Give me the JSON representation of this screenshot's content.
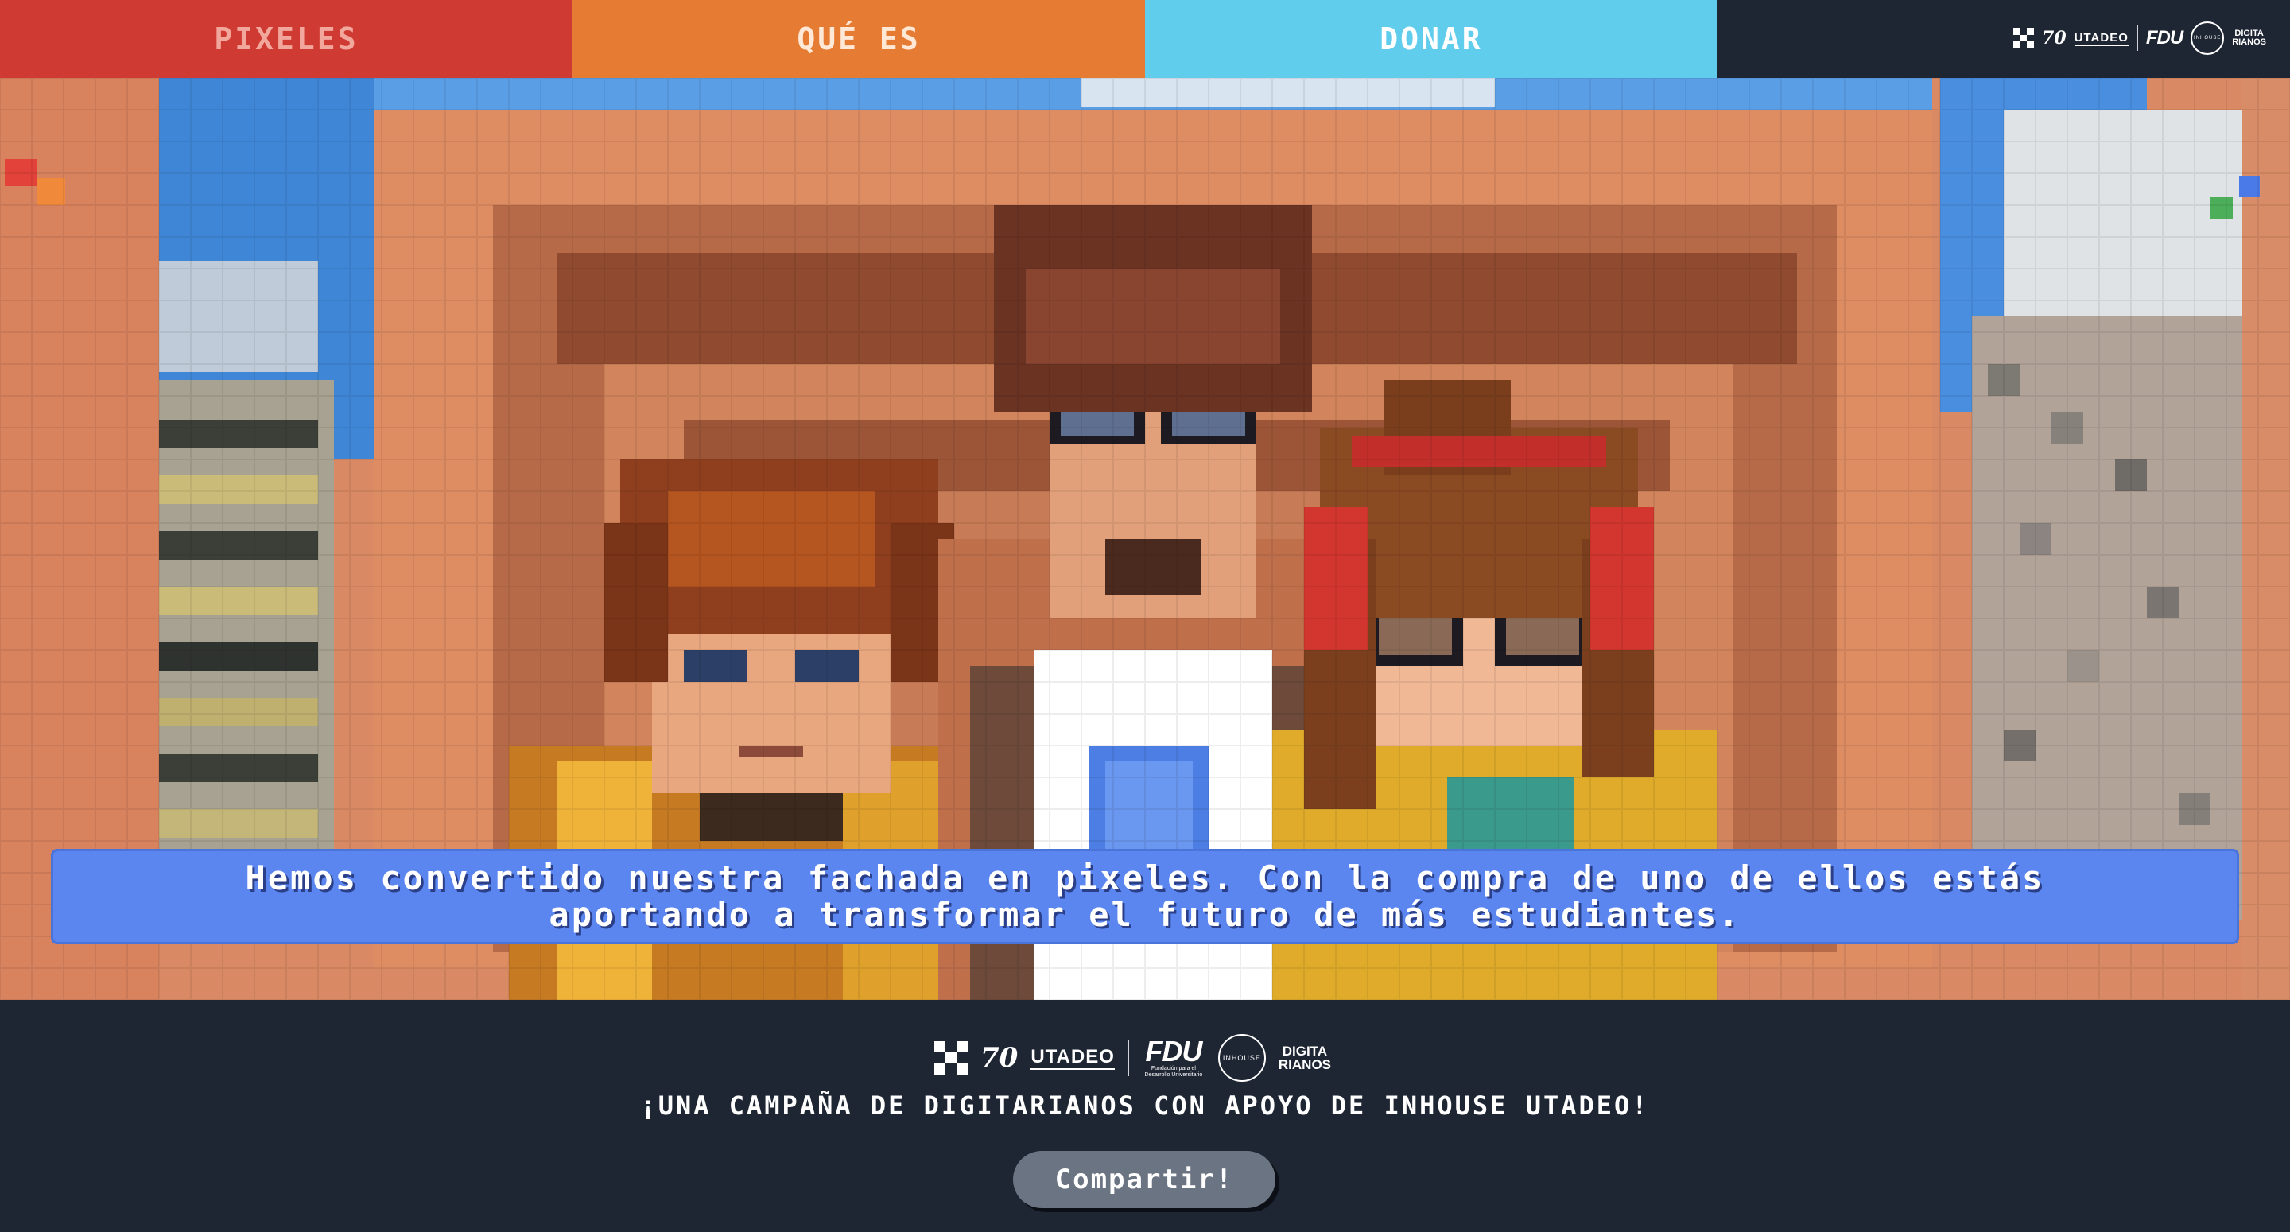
{
  "nav": {
    "tabs": [
      {
        "label": "PIXELES"
      },
      {
        "label": "QUÉ ES"
      },
      {
        "label": "DONAR"
      }
    ],
    "logos": {
      "anniversary": "70",
      "university": "UTADEO",
      "foundation": "FDU",
      "inhouse": "INHOUSE",
      "digitarianos_line1": "DIGITA",
      "digitarianos_line2": "RIANOS"
    }
  },
  "hero": {
    "banner_line1": "Hemos convertido nuestra fachada en pixeles. Con la compra de uno de ellos estás",
    "banner_line2": "aportando a transformar el futuro de más estudiantes."
  },
  "footer": {
    "logos": {
      "anniversary": "70",
      "university": "UTADEO",
      "foundation": "FDU",
      "foundation_caption": "Fundación para el Desarrollo Universitario",
      "inhouse": "INHOUSE",
      "digitarianos_line1": "DIGITA",
      "digitarianos_line2": "RIANOS"
    },
    "campaign_text": "¡UNA CAMPAÑA DE DIGITARIANOS CON APOYO DE INHOUSE UTADEO!",
    "share_label": "Compartir!"
  },
  "colors": {
    "nav_red": "#cf3a33",
    "nav_orange": "#e67b34",
    "nav_cyan": "#61cdec",
    "dark_bg": "#1f2633",
    "banner_blue": "#5b86f0",
    "button_gray": "#6b7482"
  }
}
